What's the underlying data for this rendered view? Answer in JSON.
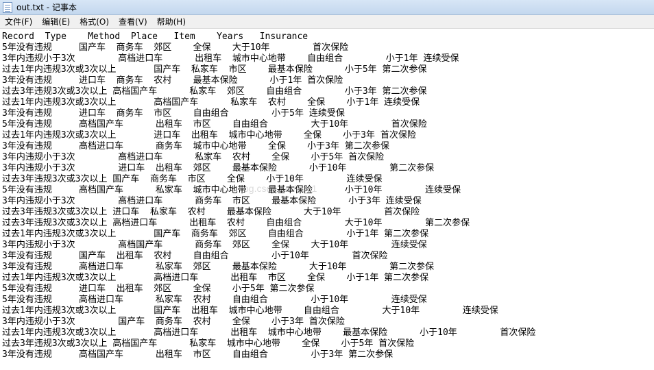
{
  "window": {
    "title": "out.txt - 记事本",
    "icon": "notepad-icon"
  },
  "menu": [
    "文件(F)",
    "编辑(E)",
    "格式(O)",
    "查看(V)",
    "帮助(H)"
  ],
  "watermark": "og.csdn.net/qq_1",
  "lines": [
    "Record  Type    Method  Place   Item    Years   Insurance",
    "5年没有违规     国产车  商务车  郊区    全保    大于10年        首次保险",
    "3年内违规小于3次        高档进口车      出租车  城市中心地带    自由组合        小于1年 连续受保",
    "过去1年内违规3次或3次以上       国产车  私家车  市区    最基本保险      小于5年 第二次参保",
    "3年没有违规     进口车  商务车  农村    最基本保险      小于1年 首次保险",
    "过去3年违规3次或3次以上 高档国产车      私家车  郊区    自由组合        小于3年 第二次参保",
    "过去1年内违规3次或3次以上       高档国产车      私家车  农村    全保    小于1年 连续受保",
    "3年没有违规     进口车  商务车  市区    自由组合        小于5年 连续受保",
    "5年没有违规     高档国产车      出租车  市区    自由组合        大于10年        首次保险",
    "过去1年内违规3次或3次以上       进口车  出租车  城市中心地带    全保    小于3年 首次保险",
    "3年没有违规     高档进口车      商务车  城市中心地带    全保    小于3年 第二次参保",
    "3年内违规小于3次        高档进口车      私家车  农村    全保    小于5年 首次保险",
    "3年内违规小于3次        进口车  出租车  郊区    最基本保险      小于10年        第二次参保",
    "过去3年违规3次或3次以上 国产车  商务车  市区    全保    小于10年        连续受保",
    "5年没有违规     高档国产车      私家车  城市中心地带    最基本保险      小于10年        连续受保",
    "3年内违规小于3次        高档进口车      商务车  市区    最基本保险      小于3年 连续受保",
    "过去3年违规3次或3次以上 进口车  私家车  农村    最基本保险      大于10年        首次保险",
    "过去3年违规3次或3次以上 高档进口车      出租车  农村    自由组合        大于10年        第二次参保",
    "过去1年内违规3次或3次以上       国产车  商务车  郊区    自由组合        小于1年 第二次参保",
    "3年内违规小于3次        高档国产车      商务车  郊区    全保    大于10年        连续受保",
    "3年没有违规     国产车  出租车  农村    自由组合        小于10年        首次保险",
    "3年没有违规     高档进口车      私家车  郊区    最基本保险      大于10年        第二次参保",
    "过去1年内违规3次或3次以上       高档进口车      出租车  市区    全保    小于1年 第二次参保",
    "5年没有违规     进口车  出租车  郊区    全保    小于5年 第二次参保",
    "5年没有违规     高档进口车      私家车  农村    自由组合        小于10年        连续受保",
    "过去1年内违规3次或3次以上       国产车  出租车  城市中心地带    自由组合        大于10年        连续受保",
    "3年内违规小于3次        国产车  商务车  农村    全保    小于3年 首次保险",
    "过去1年内违规3次或3次以上       高档进口车      出租车  城市中心地带    最基本保险      小于10年        首次保险",
    "过去3年违规3次或3次以上 高档国产车      私家车  城市中心地带    全保    小于5年 首次保险",
    "3年没有违规     高档国产车      出租车  市区    自由组合        小于3年 第二次参保"
  ]
}
